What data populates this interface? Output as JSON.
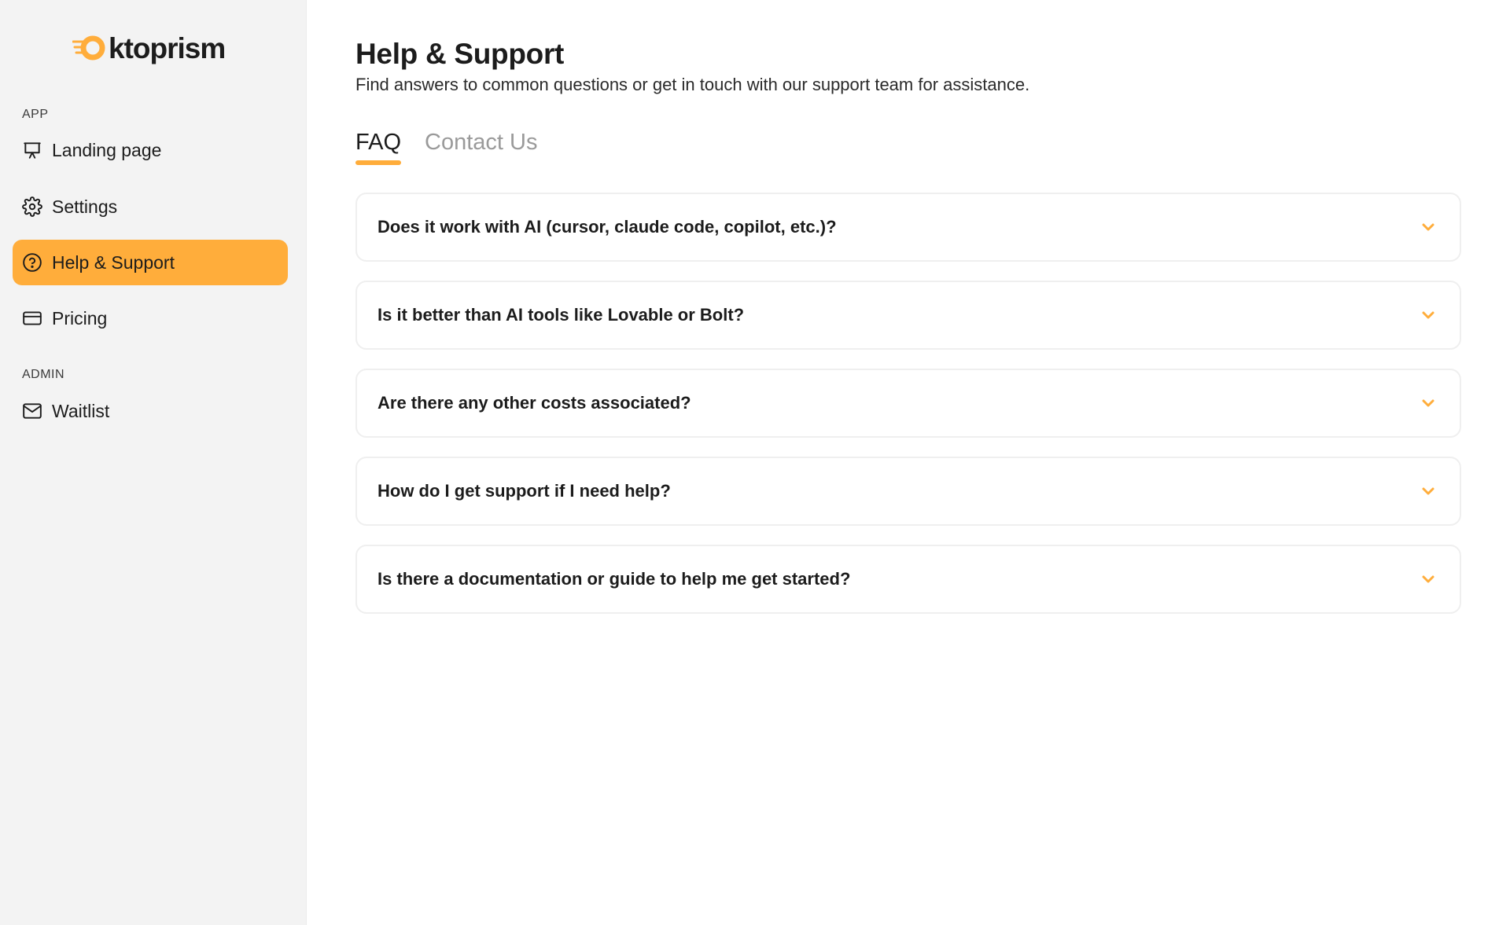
{
  "brand": {
    "name": "ktoprism",
    "accent": "#ffad3b"
  },
  "sidebar": {
    "sections": [
      {
        "label": "APP"
      },
      {
        "label": "ADMIN"
      }
    ],
    "items": [
      {
        "label": "Landing page",
        "icon": "presentation-icon"
      },
      {
        "label": "Settings",
        "icon": "gear-icon"
      },
      {
        "label": "Help & Support",
        "icon": "help-circle-icon",
        "active": true
      },
      {
        "label": "Pricing",
        "icon": "credit-card-icon"
      },
      {
        "label": "Waitlist",
        "icon": "mail-icon"
      }
    ]
  },
  "header": {
    "title": "Help & Support",
    "subtitle": "Find answers to common questions or get in touch with our support team for assistance."
  },
  "tabs": [
    {
      "label": "FAQ",
      "active": true
    },
    {
      "label": "Contact Us",
      "active": false
    }
  ],
  "faq": [
    {
      "question": "Does it work with AI (cursor, claude code, copilot, etc.)?"
    },
    {
      "question": "Is it better than AI tools like Lovable or Bolt?"
    },
    {
      "question": "Are there any other costs associated?"
    },
    {
      "question": "How do I get support if I need help?"
    },
    {
      "question": "Is there a documentation or guide to help me get started?"
    }
  ]
}
